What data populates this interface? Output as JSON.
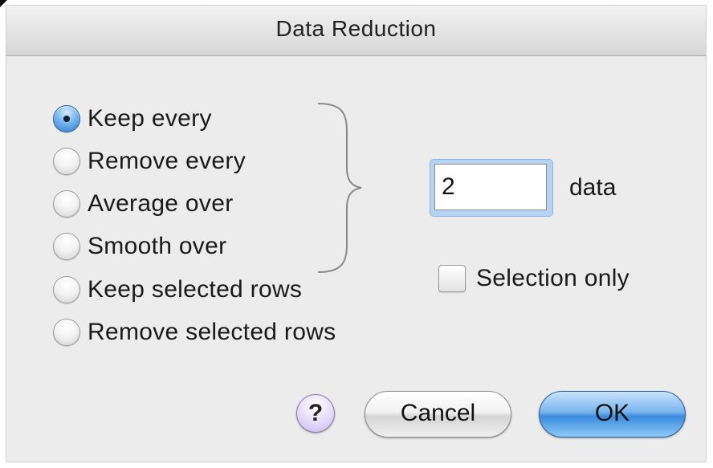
{
  "window": {
    "title": "Data Reduction"
  },
  "options": [
    {
      "label": "Keep every",
      "checked": true
    },
    {
      "label": "Remove every",
      "checked": false
    },
    {
      "label": "Average over",
      "checked": false
    },
    {
      "label": "Smooth over",
      "checked": false
    },
    {
      "label": "Keep selected rows",
      "checked": false
    },
    {
      "label": "Remove selected rows",
      "checked": false
    }
  ],
  "count_field": {
    "value": "2",
    "unit_label": "data"
  },
  "selection_only": {
    "label": "Selection only",
    "checked": false
  },
  "buttons": {
    "help_label": "?",
    "cancel_label": "Cancel",
    "ok_label": "OK"
  },
  "colors": {
    "accent": "#3b8bde",
    "help": "#c7b8ee"
  }
}
